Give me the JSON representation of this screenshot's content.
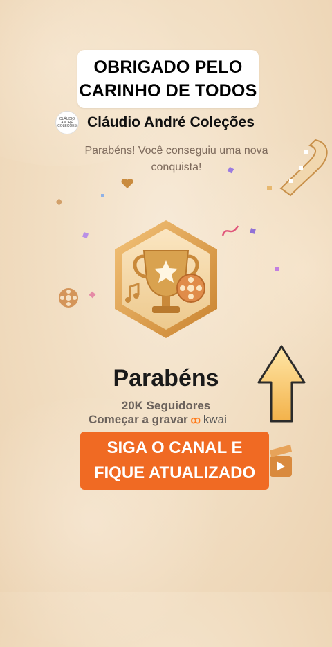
{
  "overlay_title": {
    "line1": "OBRIGADO PELO",
    "line2": "CARINHO DE TODOS"
  },
  "channel": {
    "logo_text": "CLÁUDIO ANDRÉ COLEÇÕES",
    "name": "Cláudio André Coleções"
  },
  "achievement": {
    "message": "Parabéns! Você conseguiu uma nova conquista!",
    "badge_icon": "trophy-film-reel-badge-icon",
    "heading": "Parabéns",
    "followers": "20K Seguidores",
    "start_recording": "Começar a gravar",
    "brand": "kwai"
  },
  "cta": {
    "line1": "SIGA O CANAL E",
    "line2": "FIQUE ATUALIZADO"
  },
  "colors": {
    "accent": "#f06a23",
    "badge_gold": "#d9a24f",
    "background": "#f2dfc4"
  }
}
